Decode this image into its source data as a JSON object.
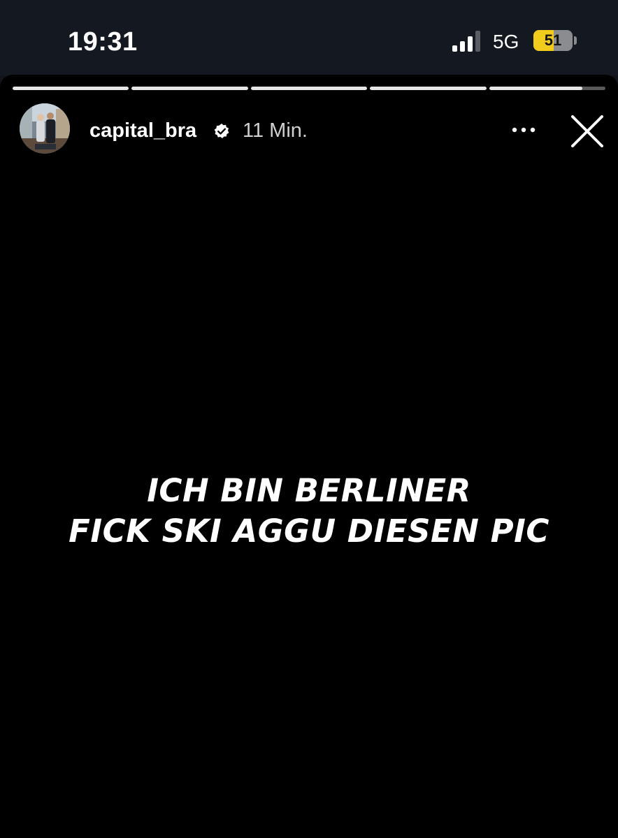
{
  "status_bar": {
    "time": "19:31",
    "network": "5G",
    "battery_level": "51",
    "battery_fraction": 0.51,
    "signal_bars_active": 3,
    "signal_bars_total": 4
  },
  "story": {
    "progress_segments": [
      1,
      1,
      1,
      1,
      0.8
    ],
    "username": "capital_bra",
    "verified_icon": "verified-badge-icon",
    "time_ago": "11 Min.",
    "more_icon": "more-options-icon",
    "close_icon": "close-icon",
    "text_lines": [
      "ICH BIN BERLINER",
      "FICK SKI AGGU DIESEN PIC"
    ]
  },
  "colors": {
    "background": "#000000",
    "status_bar_bg": "#141820",
    "battery_accent": "#f2cc1c",
    "text": "#ffffff"
  }
}
